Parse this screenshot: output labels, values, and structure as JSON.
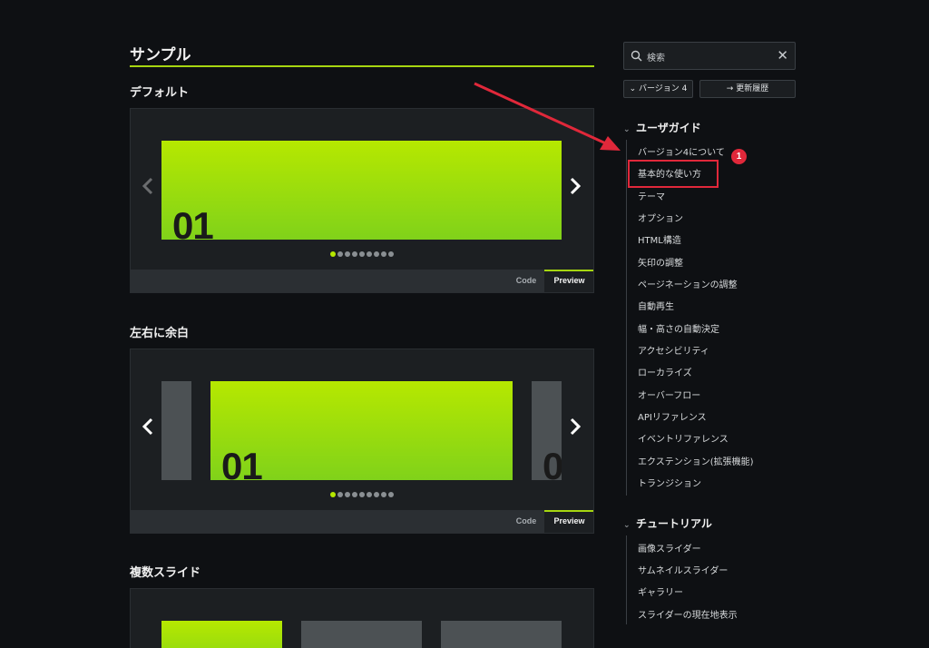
{
  "main": {
    "page_title": "サンプル",
    "sections": [
      {
        "title": "デフォルト",
        "slide_number": "01",
        "tabs": {
          "code": "Code",
          "preview": "Preview"
        }
      },
      {
        "title": "左右に余白",
        "slide_number": "01",
        "peek_number": "0",
        "tabs": {
          "code": "Code",
          "preview": "Preview"
        }
      },
      {
        "title": "複数スライド"
      }
    ],
    "dot_count": 9,
    "active_dot": 0
  },
  "sidebar": {
    "search_placeholder": "検索",
    "version_button": "バージョン 4",
    "changelog_button": "更新履歴",
    "groups": [
      {
        "title": "ユーザガイド",
        "items": [
          "バージョン4について",
          "基本的な使い方",
          "テーマ",
          "オプション",
          "HTML構造",
          "矢印の調整",
          "ページネーションの調整",
          "自動再生",
          "幅・高さの自動決定",
          "アクセシビリティ",
          "ローカライズ",
          "オーバーフロー",
          "APIリファレンス",
          "イベントリファレンス",
          "エクステンション(拡張機能)",
          "トランジション"
        ]
      },
      {
        "title": "チュートリアル",
        "items": [
          "画像スライダー",
          "サムネイルスライダー",
          "ギャラリー",
          "スライダーの現在地表示"
        ]
      }
    ]
  },
  "annotation": {
    "badge": "1",
    "highlighted_item": "基本的な使い方",
    "color": "#e0283a"
  },
  "colors": {
    "accent": "#a6d610",
    "background": "#0e1013"
  }
}
